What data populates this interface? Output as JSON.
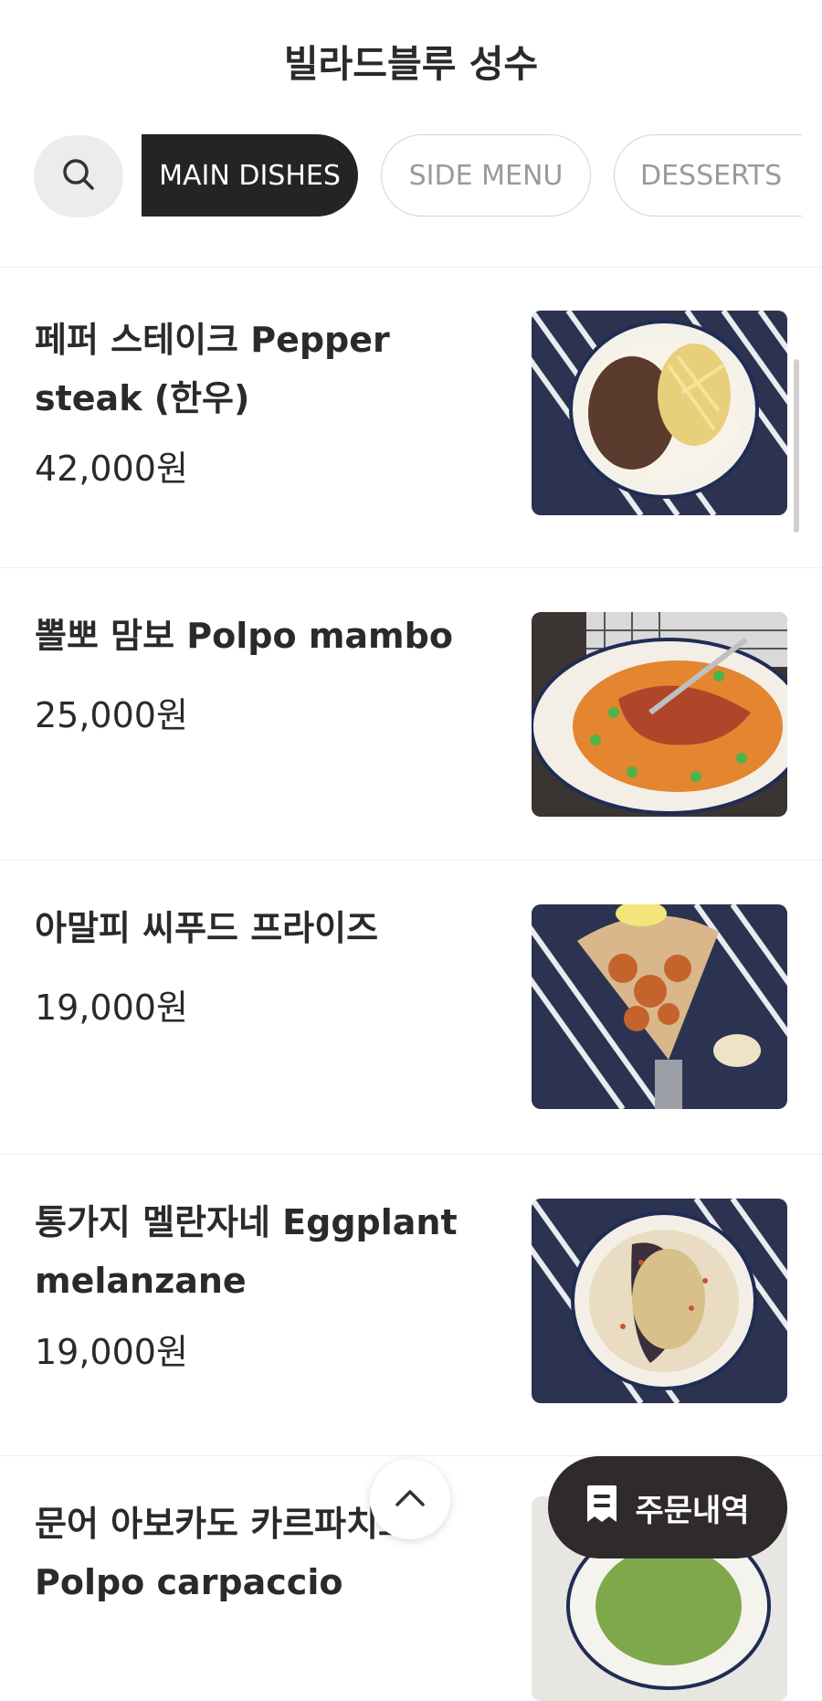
{
  "header": {
    "title": "빌라드블루 성수"
  },
  "categories": {
    "search_icon": "search-icon",
    "tabs": [
      {
        "label": "MAIN DISHES",
        "active": true
      },
      {
        "label": "SIDE MENU",
        "active": false
      },
      {
        "label": "DESSERTS",
        "active": false
      }
    ]
  },
  "menu": {
    "items": [
      {
        "name": "페퍼 스테이크 Pepper steak (한우)",
        "price": "42,000원"
      },
      {
        "name": "뽈뽀 맘보 Polpo mambo",
        "price": "25,000원"
      },
      {
        "name": "아말피 씨푸드 프라이즈",
        "price": "19,000원"
      },
      {
        "name": "통가지 멜란자네 Eggplant melanzane",
        "price": "19,000원"
      },
      {
        "name": "문어 아보카도 카르파치오 Polpo carpaccio",
        "price": ""
      }
    ]
  },
  "floating": {
    "top_icon": "chevron-up-icon",
    "order_label": "주문내역",
    "order_icon": "receipt-icon"
  },
  "colors": {
    "accent_dark": "#242424",
    "order_button": "#2f2a2c",
    "tablecloth_navy": "#2b3350"
  }
}
